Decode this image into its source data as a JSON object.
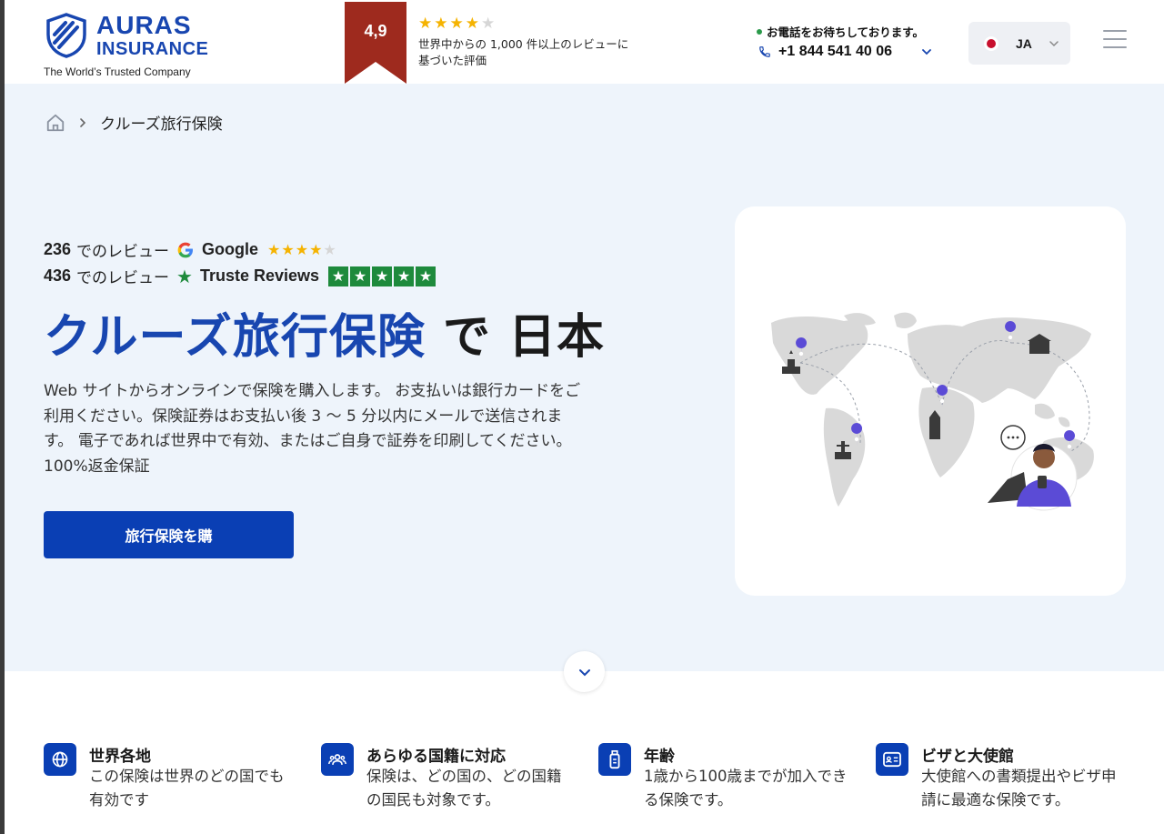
{
  "header": {
    "brand_line1": "AURAS",
    "brand_line2": "INSURANCE",
    "tagline": "The World’s Trusted Company",
    "rating_value": "4,9",
    "rating_stars_filled": 4,
    "rating_text": "世界中からの 1,000 件以上のレビューに基づいた評価",
    "call_label": "お電話をお待ちしております。",
    "phone": "+1 844 541 40 06",
    "language": "JA"
  },
  "breadcrumb": {
    "current": "クルーズ旅行保険"
  },
  "reviews": {
    "google": {
      "count": "236",
      "label": "でのレビュー",
      "brand": "Google",
      "stars_filled": 4
    },
    "trust": {
      "count": "436",
      "label": "でのレビュー",
      "brand": "Truste Reviews",
      "stars_filled": 5
    }
  },
  "hero": {
    "title_highlight": "クルーズ旅行保険",
    "title_rest": "で 日本",
    "description": "Web サイトからオンラインで保険を購入します。 お支払いは銀行カードをご利用ください。保険証券はお支払い後 3 〜 5 分以内にメールで送信されます。 電子であれば世界中で有効、またはご自身で証券を印刷してください。100%返金保証",
    "cta": "旅行保険を購"
  },
  "features": [
    {
      "icon": "globe-icon",
      "title": "世界各地",
      "desc": "この保険は世界のどの国でも有効です"
    },
    {
      "icon": "people-icon",
      "title": "あらゆる国籍に対応",
      "desc": "保険は、どの国の、どの国籍の国民も対象です。"
    },
    {
      "icon": "age-icon",
      "title": "年齢",
      "desc": "1歳から100歳までが加入できる保険です。"
    },
    {
      "icon": "id-card-icon",
      "title": "ビザと大使館",
      "desc": "大使館への書類提出やビザ申請に最適な保険です。"
    }
  ],
  "colors": {
    "brand_blue": "#1846b0",
    "cta_blue": "#0a3fb4",
    "ribbon_red": "#9e2a1e",
    "star_gold": "#f5b301",
    "trust_green": "#1e8a3c",
    "hero_bg": "#eef4fb"
  }
}
